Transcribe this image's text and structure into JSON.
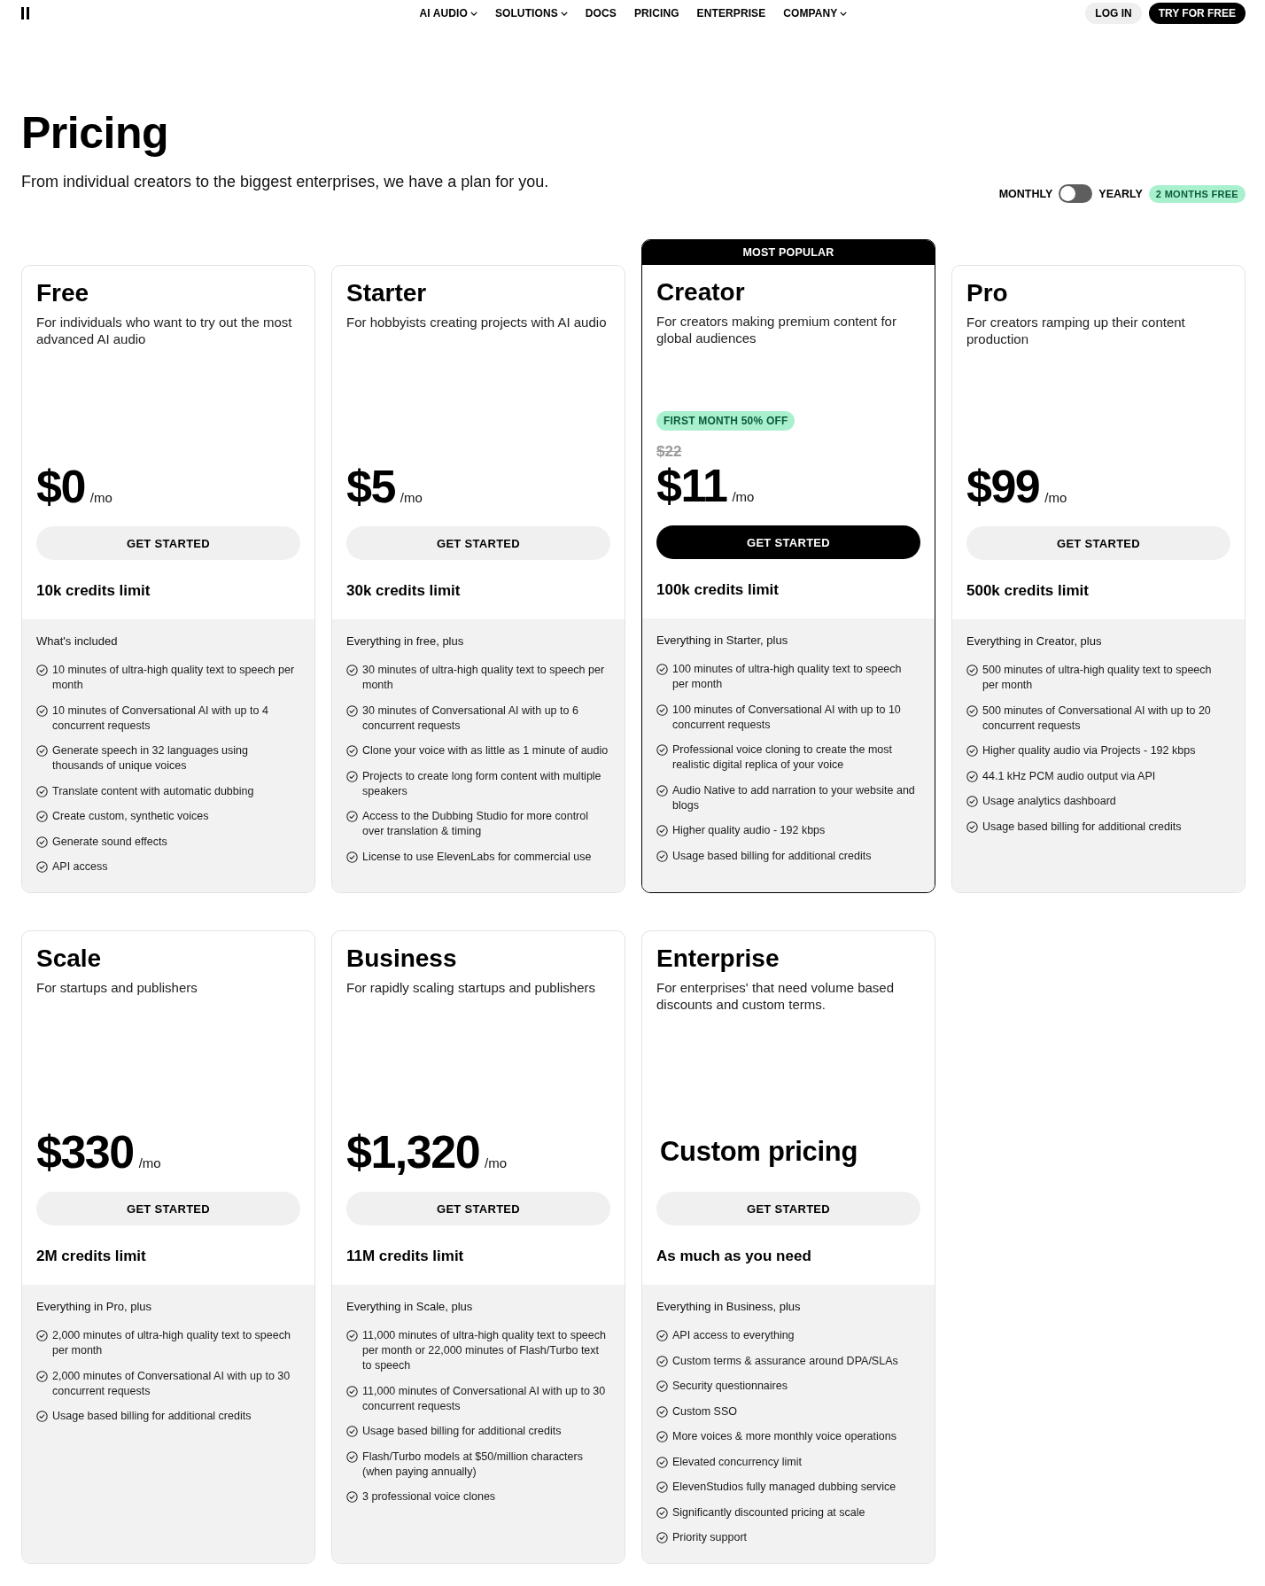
{
  "header": {
    "nav": [
      {
        "label": "AI AUDIO",
        "dropdown": true
      },
      {
        "label": "SOLUTIONS",
        "dropdown": true
      },
      {
        "label": "DOCS",
        "dropdown": false
      },
      {
        "label": "PRICING",
        "dropdown": false
      },
      {
        "label": "ENTERPRISE",
        "dropdown": false
      },
      {
        "label": "COMPANY",
        "dropdown": true
      }
    ],
    "actions": [
      {
        "label": "LOG IN",
        "kind": "secondary"
      },
      {
        "label": "TRY FOR FREE",
        "kind": "primary"
      }
    ]
  },
  "hero": {
    "title": "Pricing",
    "subtitle": "From individual creators to the biggest enterprises, we have a plan for you."
  },
  "billing_toggle": {
    "left_label": "MONTHLY",
    "right_label": "YEARLY",
    "on": false,
    "badge": "2 MONTHS FREE"
  },
  "plans": [
    {
      "name": "Free",
      "description": "For individuals who want to try out the most advanced AI audio",
      "kind": "amount",
      "price": "$0",
      "period": "/mo",
      "button": "GET STARTED",
      "popular": false,
      "credits": "10k credits limit",
      "features_heading": "What's included",
      "features": [
        "10 minutes of ultra-high quality text to speech per month",
        "10 minutes of Conversational AI with up to 4 concurrent requests",
        "Generate speech in 32 languages using thousands of unique voices",
        "Translate content with automatic dubbing",
        "Create custom, synthetic voices",
        "Generate sound effects",
        "API access"
      ]
    },
    {
      "name": "Starter",
      "description": "For hobbyists creating projects with AI audio",
      "kind": "amount",
      "price": "$5",
      "period": "/mo",
      "button": "GET STARTED",
      "popular": false,
      "credits": "30k credits limit",
      "features_heading": "Everything in free, plus",
      "features": [
        "30 minutes of ultra-high quality text to speech per month",
        "30 minutes of Conversational AI with up to 6 concurrent requests",
        "Clone your voice with as little as 1 minute of audio",
        "Projects to create long form content with multiple speakers",
        "Access to the Dubbing Studio for more control over translation & timing",
        "License to use ElevenLabs for commercial use"
      ]
    },
    {
      "name": "Creator",
      "description": "For creators making premium content for global audiences",
      "kind": "amount",
      "popular_label": "MOST POPULAR",
      "promo": "FIRST MONTH 50% OFF",
      "original_price": "$22",
      "price": "$11",
      "period": "/mo",
      "button": "GET STARTED",
      "popular": true,
      "credits": "100k credits limit",
      "features_heading": "Everything in Starter, plus",
      "features": [
        "100 minutes of ultra-high quality text to speech per month",
        "100 minutes of Conversational AI with up to 10 concurrent requests",
        "Professional voice cloning to create the most realistic digital replica of your voice",
        "Audio Native to add narration to your website and blogs",
        "Higher quality audio - 192 kbps",
        "Usage based billing for additional credits"
      ]
    },
    {
      "name": "Pro",
      "description": "For creators ramping up their content production",
      "kind": "amount",
      "price": "$99",
      "period": "/mo",
      "button": "GET STARTED",
      "popular": false,
      "credits": "500k credits limit",
      "features_heading": "Everything in Creator, plus",
      "features": [
        "500 minutes of ultra-high quality text to speech per month",
        "500 minutes of Conversational AI with up to 20 concurrent requests",
        "Higher quality audio via Projects - 192 kbps",
        "44.1 kHz PCM audio output via API",
        "Usage analytics dashboard",
        "Usage based billing for additional credits"
      ]
    },
    {
      "name": "Scale",
      "description": "For startups and publishers",
      "kind": "amount",
      "price": "$330",
      "period": "/mo",
      "button": "GET STARTED",
      "popular": false,
      "credits": "2M credits limit",
      "features_heading": "Everything in Pro, plus",
      "features": [
        "2,000 minutes of ultra-high quality text to speech per month",
        "2,000 minutes of Conversational AI with up to 30 concurrent requests",
        "Usage based billing for additional credits"
      ]
    },
    {
      "name": "Business",
      "description": "For rapidly scaling startups and publishers",
      "kind": "amount",
      "price": "$1,320",
      "period": "/mo",
      "button": "GET STARTED",
      "popular": false,
      "credits": "11M credits limit",
      "features_heading": "Everything in Scale, plus",
      "features": [
        "11,000 minutes of ultra-high quality text to speech per month or 22,000 minutes of Flash/Turbo text to speech",
        "11,000 minutes of Conversational AI with up to 30 concurrent requests",
        "Usage based billing for additional credits",
        "Flash/Turbo models at $50/million characters (when paying annually)",
        "3 professional voice clones"
      ]
    },
    {
      "name": "Enterprise",
      "description": "For enterprises' that need volume based discounts and custom terms.",
      "kind": "custom",
      "price": "Custom pricing",
      "button": "GET STARTED",
      "popular": false,
      "credits": "As much as you need",
      "features_heading": "Everything in Business, plus",
      "features": [
        "API access to everything",
        "Custom terms & assurance around DPA/SLAs",
        "Security questionnaires",
        "Custom SSO",
        "More voices & more monthly voice operations",
        "Elevated concurrency limit",
        "ElevenStudios fully managed dubbing service",
        "Significantly discounted pricing at scale",
        "Priority support"
      ]
    }
  ]
}
